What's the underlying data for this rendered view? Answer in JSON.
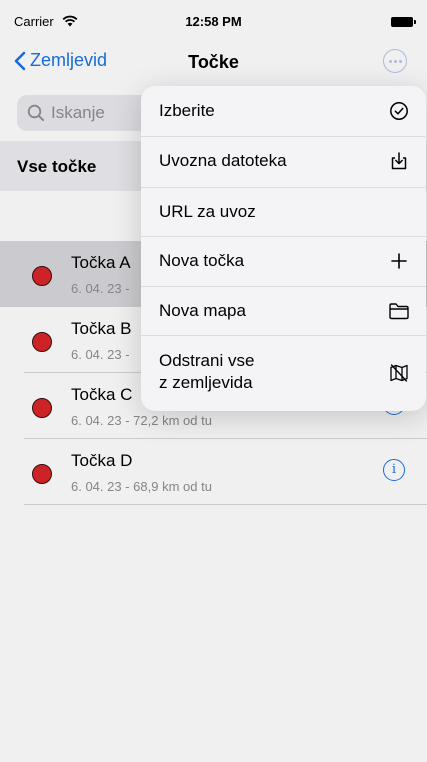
{
  "status_bar": {
    "carrier": "Carrier",
    "time": "12:58 PM"
  },
  "nav": {
    "back_label": "Zemljevid",
    "title": "Točke"
  },
  "search": {
    "placeholder": "Iskanje"
  },
  "section": {
    "title": "Vse točke"
  },
  "points": [
    {
      "name": "Točka A",
      "subtitle": "6. 04. 23 -",
      "color": "#d9262a"
    },
    {
      "name": "Točka B",
      "subtitle": "6. 04. 23 -",
      "color": "#d9262a"
    },
    {
      "name": "Točka C",
      "subtitle": "6. 04. 23 - 72,2 km od tu",
      "color": "#d9262a"
    },
    {
      "name": "Točka D",
      "subtitle": "6. 04. 23 - 68,9 km od tu",
      "color": "#d9262a"
    }
  ],
  "menu": {
    "items": [
      {
        "label": "Izberite",
        "icon": "checkmark-circle-icon"
      },
      {
        "label": "Uvozna datoteka",
        "icon": "import-tray-icon"
      },
      {
        "label": "URL za uvoz",
        "icon": ""
      },
      {
        "label": "Nova točka",
        "icon": "plus-icon"
      },
      {
        "label": "Nova mapa",
        "icon": "folder-icon"
      },
      {
        "label": "Odstrani vse\nz zemljevida",
        "icon": "map-slash-icon"
      }
    ]
  },
  "colors": {
    "accent": "#1a73e8",
    "point": "#d9262a"
  }
}
